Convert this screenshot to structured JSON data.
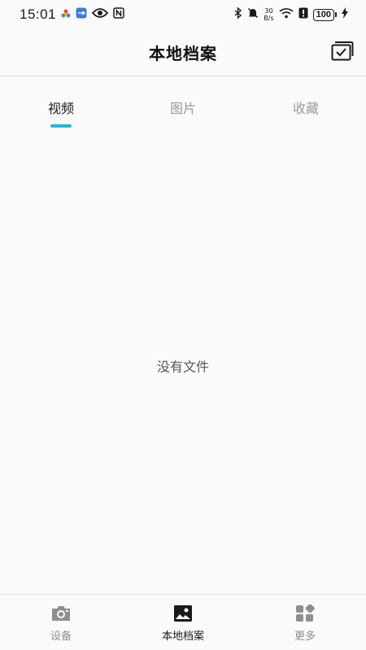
{
  "status_bar": {
    "time": "15:01",
    "net_speed_value": "30",
    "net_speed_unit": "B/s",
    "battery": "100",
    "icons": [
      "color-dots-icon",
      "usb-icon",
      "eye-icon",
      "nfc-icon",
      "bluetooth-icon",
      "mute-icon",
      "wifi-icon",
      "alert-icon",
      "charging-icon"
    ]
  },
  "header": {
    "title": "本地档案",
    "action_icon": "select-images-icon"
  },
  "tabs": [
    {
      "label": "视频",
      "active": true
    },
    {
      "label": "图片",
      "active": false
    },
    {
      "label": "收藏",
      "active": false
    }
  ],
  "empty_state": {
    "message": "没有文件"
  },
  "bottom_nav": [
    {
      "label": "设备",
      "icon": "camera-icon",
      "active": false
    },
    {
      "label": "本地档案",
      "icon": "gallery-icon",
      "active": true
    },
    {
      "label": "更多",
      "icon": "apps-icon",
      "active": false
    }
  ],
  "colors": {
    "accent": "#25b6d9",
    "background": "#fafafa",
    "inactive_text": "#9a9a9a",
    "active_text": "#1c1c1c"
  }
}
